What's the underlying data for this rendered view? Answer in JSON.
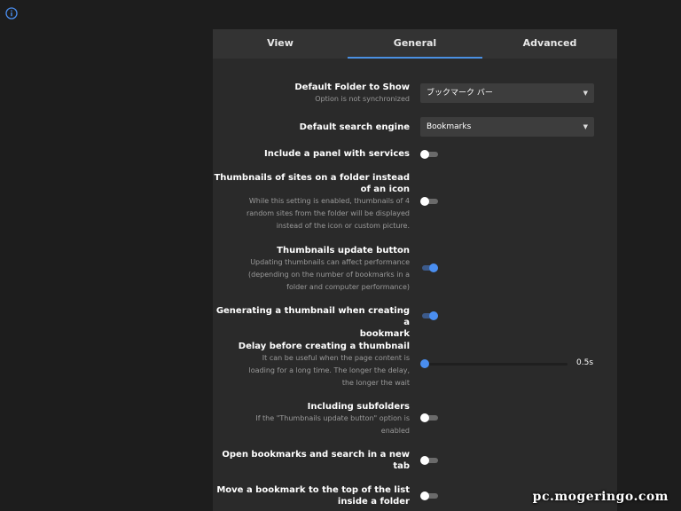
{
  "tabs": [
    {
      "label": "View",
      "active": false
    },
    {
      "label": "General",
      "active": true
    },
    {
      "label": "Advanced",
      "active": false
    }
  ],
  "settings": {
    "default_folder": {
      "label": "Default Folder to Show",
      "sub": "Option is not synchronized",
      "value": "ブックマーク バー"
    },
    "search_engine": {
      "label": "Default search engine",
      "value": "Bookmarks"
    },
    "services_panel": {
      "label": "Include a panel with services",
      "on": false
    },
    "folder_thumbnails": {
      "label_line1": "Thumbnails of sites on a folder instead",
      "label_line2": "of an icon",
      "sub_line1": "While this setting is enabled, thumbnails of 4",
      "sub_line2": "random sites from the folder will be displayed",
      "sub_line3": "instead of the icon or custom picture.",
      "on": false
    },
    "update_button": {
      "label": "Thumbnails update button",
      "sub_line1": "Updating thumbnails can affect performance",
      "sub_line2": "(depending on the number of bookmarks in a",
      "sub_line3": "folder and computer performance)",
      "on": true
    },
    "thumb_on_create": {
      "label_line1": "Generating a thumbnail when creating a",
      "label_line2": "bookmark",
      "on": true
    },
    "delay": {
      "label": "Delay before creating a thumbnail",
      "sub_line1": "It can be useful when the page content is",
      "sub_line2": "loading for a long time. The longer the delay,",
      "sub_line3": "the longer the wait",
      "value": "0.5s",
      "fraction": 0
    },
    "subfolders": {
      "label": "Including subfolders",
      "sub_line1": "If the \"Thumbnails update button\" option is",
      "sub_line2": "enabled",
      "on": false
    },
    "new_tab": {
      "label_line1": "Open bookmarks and search in a new",
      "label_line2": "tab",
      "on": false
    },
    "move_top": {
      "label_line1": "Move a bookmark to the top of the list",
      "label_line2": "inside a folder",
      "on": false
    }
  },
  "watermark": "pc.mogeringo.com",
  "colors": {
    "accent": "#4a8ef0",
    "background": "#1d1d1d",
    "panel": "#2a2a2a"
  },
  "icons": {
    "info": "info-icon",
    "dropdown": "caret-down-icon"
  }
}
